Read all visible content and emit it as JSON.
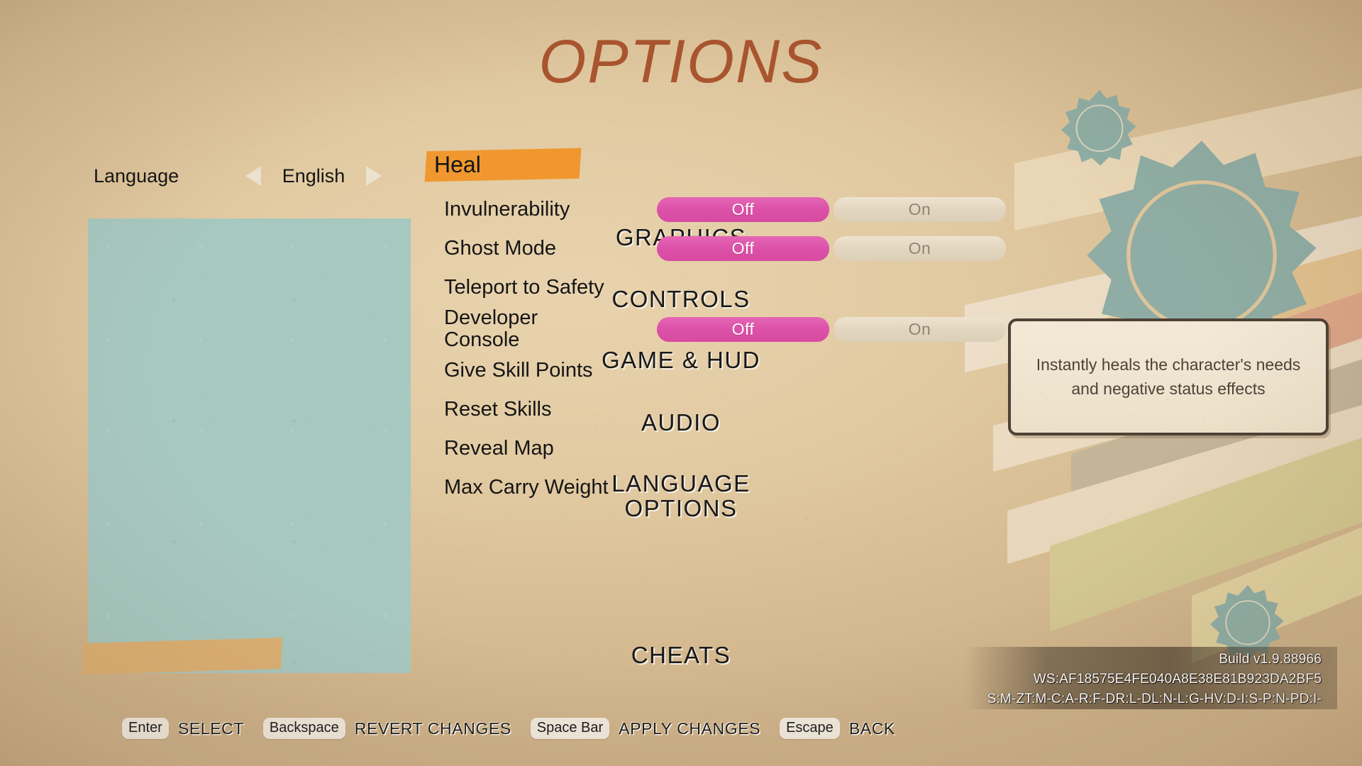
{
  "title": "OPTIONS",
  "colors": {
    "paper": "#e2cba3",
    "title_rust": "#a9552f",
    "sidebar_teal": "#a7c8c0",
    "cheats_highlight": "#dcb073",
    "heal_highlight": "#f0982f",
    "toggle_active_pink": "#dc52a8",
    "toggle_inactive_cream": "#e3d6c0",
    "gear_sage": "#8fada4",
    "tooltip_border": "#4e4237"
  },
  "language": {
    "label": "Language",
    "left_arrow_icon": "triangle-left-icon",
    "right_arrow_icon": "triangle-right-icon",
    "value": "English"
  },
  "sidebar": {
    "items": [
      {
        "label": "GRAPHICS",
        "selected": false
      },
      {
        "label": "CONTROLS",
        "selected": false
      },
      {
        "label": "GAME & HUD",
        "selected": false
      },
      {
        "label": "AUDIO",
        "selected": false
      },
      {
        "label": "LANGUAGE OPTIONS",
        "line1": "LANGUAGE",
        "line2": "OPTIONS",
        "selected": false
      },
      {
        "label": "CHEATS",
        "selected": true
      }
    ]
  },
  "main": {
    "section_header": "Heal",
    "toggle_labels": {
      "off": "Off",
      "on": "On"
    },
    "options": [
      {
        "name": "Invulnerability",
        "has_toggle": true,
        "value": "Off"
      },
      {
        "name": "Ghost Mode",
        "has_toggle": true,
        "value": "Off"
      },
      {
        "name": "Teleport to Safety",
        "has_toggle": false,
        "value": ""
      },
      {
        "name": "Developer Console",
        "name_line1": "Developer",
        "name_line2": "Console",
        "has_toggle": true,
        "value": "Off"
      },
      {
        "name": "Give Skill Points",
        "has_toggle": false,
        "value": ""
      },
      {
        "name": "Reset Skills",
        "has_toggle": false,
        "value": ""
      },
      {
        "name": "Reveal Map",
        "has_toggle": false,
        "value": ""
      },
      {
        "name": "Max Carry Weight",
        "has_toggle": false,
        "value": ""
      }
    ]
  },
  "tooltip": {
    "text": "Instantly heals the character's needs and negative status effects"
  },
  "build_info": {
    "line1": "Build v1.9.88966",
    "line2": "WS:AF18575E4FE040A8E38E81B923DA2BF5",
    "line3": "S:M-ZT:M-C:A-R:F-DR:L-DL:N-L:G-HV:D-I:S-P:N-PD:I-"
  },
  "hotkeys": [
    {
      "key": "Enter",
      "action": "SELECT"
    },
    {
      "key": "Backspace",
      "action": "REVERT CHANGES"
    },
    {
      "key": "Space Bar",
      "action": "APPLY CHANGES"
    },
    {
      "key": "Escape",
      "action": "BACK"
    }
  ]
}
